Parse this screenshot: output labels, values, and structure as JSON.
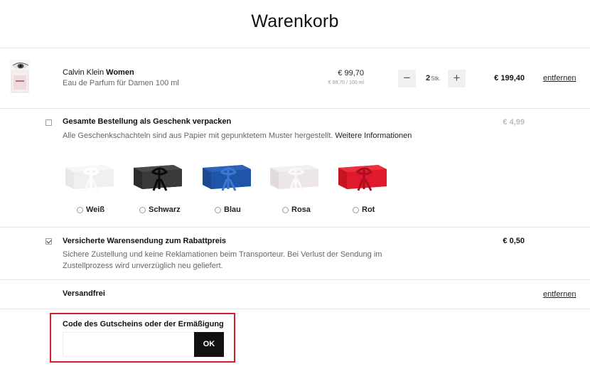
{
  "page": {
    "title": "Warenkorb"
  },
  "product": {
    "brand": "Calvin Klein",
    "name": "Women",
    "subtitle": "Eau de Parfum für Damen 100 ml",
    "unit_price": "€ 99,70",
    "unit_price_per": "€ 99,70 / 100 ml",
    "qty_minus": "−",
    "qty_plus": "+",
    "qty_value": "2",
    "qty_unit": "Stk.",
    "total": "€ 199,40",
    "remove_label": "entfernen"
  },
  "gift": {
    "checked": false,
    "title": "Gesamte Bestellung als Geschenk verpacken",
    "text": "Alle Geschenkschachteln sind aus Papier mit gepunktetem Muster hergestellt.",
    "more": "Weitere Informationen",
    "price": "€ 4,99",
    "options": [
      {
        "label": "Weiß",
        "color": "#f3f3f3",
        "ribbon": "#ffffff"
      },
      {
        "label": "Schwarz",
        "color": "#3a3a3a",
        "ribbon": "#111111"
      },
      {
        "label": "Blau",
        "color": "#1f55a8",
        "ribbon": "#2a67c4"
      },
      {
        "label": "Rosa",
        "color": "#ece6e8",
        "ribbon": "#f7f2f4"
      },
      {
        "label": "Rot",
        "color": "#e01a2c",
        "ribbon": "#c8102a"
      }
    ]
  },
  "insurance": {
    "checked": true,
    "title": "Versicherte Warensendung zum Rabattpreis",
    "text_line1": "Sichere Zustellung und keine Reklamationen beim Transporteur. Bei Verlust der Sendung im",
    "text_line2": "Zustellprozess wird unverzüglich neu geliefert.",
    "price": "€ 0,50"
  },
  "shipping": {
    "label": "Versandfrei",
    "remove_label": "entfernen"
  },
  "coupon": {
    "label": "Code des Gutscheins oder der Ermäßigung",
    "value": "",
    "placeholder": "",
    "button_label": "OK",
    "highlight_color": "#d41f2b"
  }
}
